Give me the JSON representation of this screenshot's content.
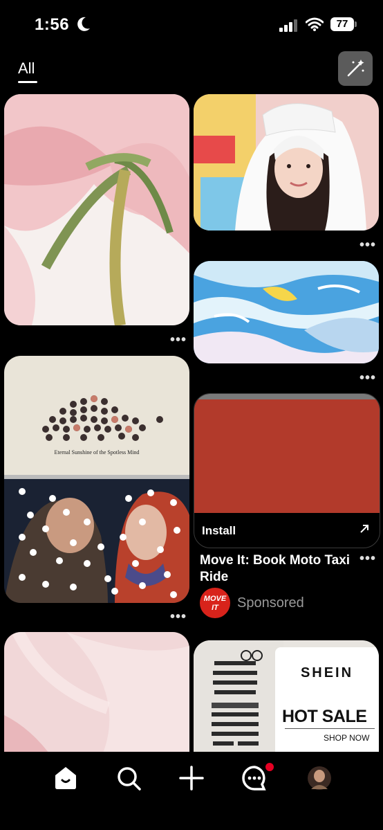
{
  "status_bar": {
    "time": "1:56",
    "battery": "77"
  },
  "header": {
    "tab_label": "All"
  },
  "pins": [
    {
      "name": "pink-rose-stem"
    },
    {
      "name": "girl-white-bunny-hat"
    },
    {
      "name": "blue-water-illustration"
    },
    {
      "name": "eternal-sunshine-collage",
      "caption": "Eternal Sunshine of the Spotless Mind"
    },
    {
      "name": "pink-petal-closeup"
    }
  ],
  "ad": {
    "install_label": "Install",
    "title": "Move It: Book Moto Taxi Ride",
    "brand_logo_text": "MOVE IT",
    "sponsored_label": "Sponsored",
    "accent_color": "#b23a2b"
  },
  "shein_pin": {
    "brand": "SHEIN",
    "headline": "HOT SALE",
    "cta": "SHOP NOW"
  },
  "nav": {
    "items": [
      "home-icon",
      "search-icon",
      "create-icon",
      "messages-icon",
      "profile-avatar"
    ],
    "notification_color": "#e60023"
  }
}
